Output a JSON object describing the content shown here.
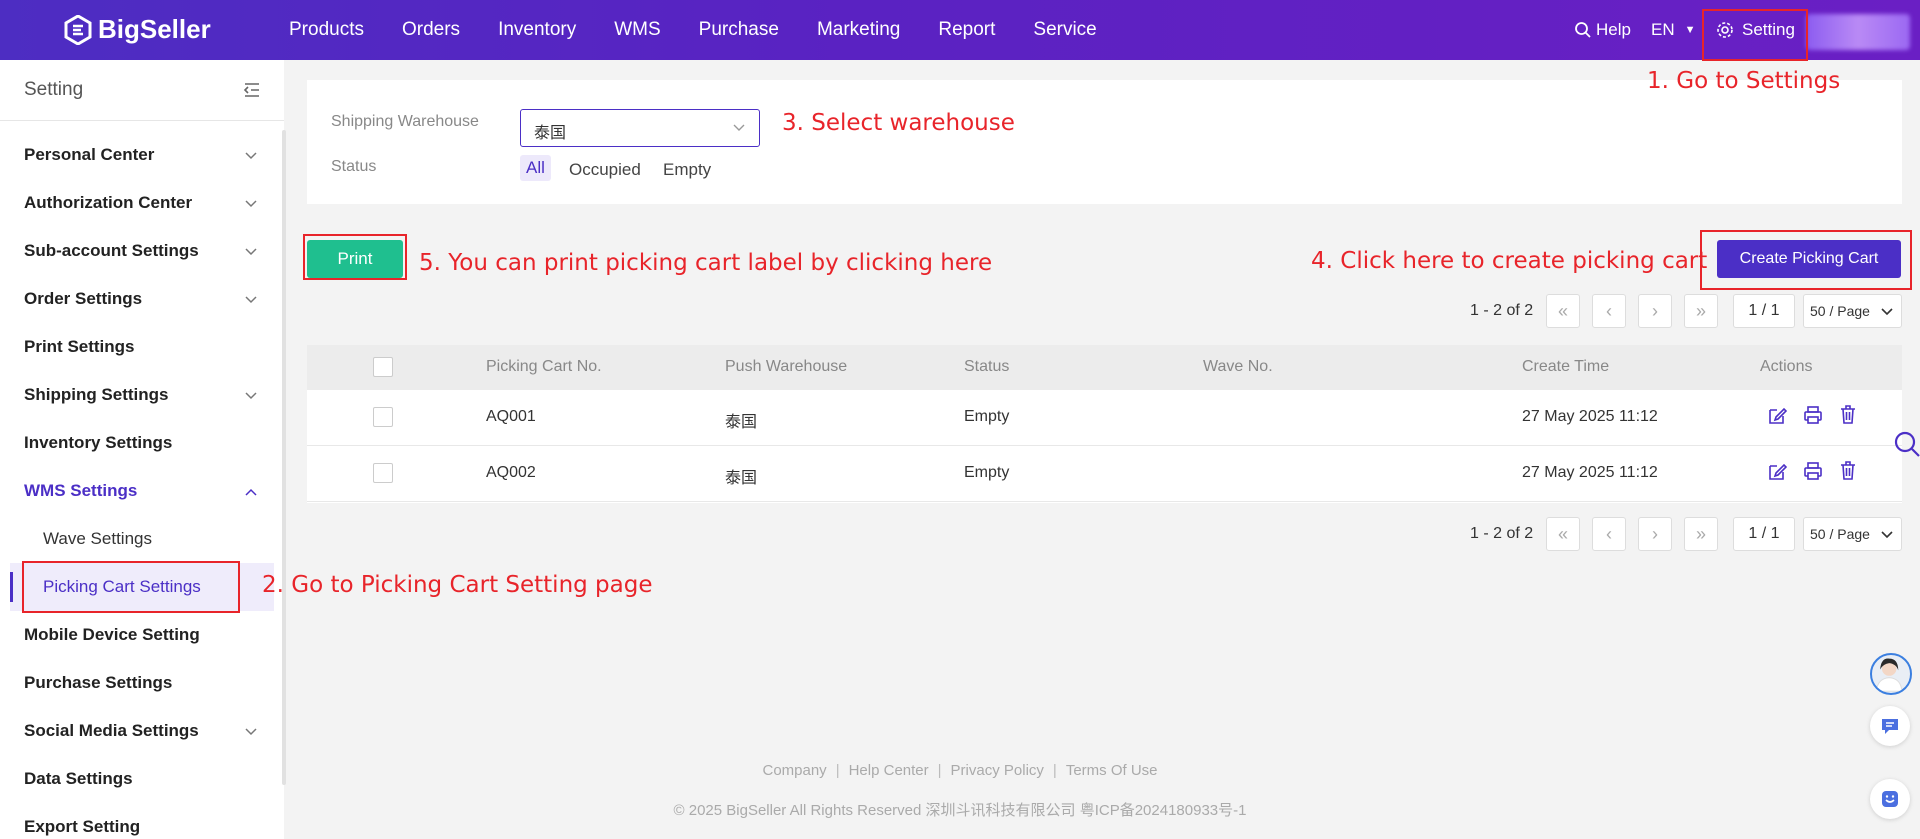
{
  "brand": {
    "name": "BigSeller"
  },
  "nav": {
    "items": [
      "Products",
      "Orders",
      "Inventory",
      "WMS",
      "Purchase",
      "Marketing",
      "Report",
      "Service"
    ]
  },
  "topright": {
    "help": "Help",
    "lang": "EN",
    "setting": "Setting"
  },
  "annotations": {
    "a1": "1. Go to Settings",
    "a2": "2. Go to Picking Cart Setting page",
    "a3": "3. Select warehouse",
    "a4": "4. Click here to create picking cart",
    "a5": "5. You can print picking cart label by clicking here"
  },
  "sidebar": {
    "title": "Setting",
    "items": [
      {
        "label": "Personal Center"
      },
      {
        "label": "Authorization Center"
      },
      {
        "label": "Sub-account Settings"
      },
      {
        "label": "Order Settings"
      },
      {
        "label": "Print Settings"
      },
      {
        "label": "Shipping Settings"
      },
      {
        "label": "Inventory Settings"
      },
      {
        "label": "WMS Settings"
      },
      {
        "label": "Mobile Device Setting"
      },
      {
        "label": "Purchase Settings"
      },
      {
        "label": "Social Media Settings"
      },
      {
        "label": "Data Settings"
      },
      {
        "label": "Export Setting"
      }
    ],
    "sub": [
      "Wave Settings",
      "Picking Cart Settings"
    ]
  },
  "filter": {
    "warehouse_label": "Shipping Warehouse",
    "warehouse_value": "泰国",
    "status_label": "Status",
    "status_options": [
      "All",
      "Occupied",
      "Empty"
    ]
  },
  "buttons": {
    "print": "Print",
    "create": "Create Picking Cart"
  },
  "pager": {
    "total": "1 - 2 of 2",
    "page": "1 / 1",
    "size": "50 / Page"
  },
  "table": {
    "headers": [
      "Picking Cart No.",
      "Push Warehouse",
      "Status",
      "Wave No.",
      "Create Time",
      "Actions"
    ],
    "rows": [
      {
        "no": "AQ001",
        "warehouse": "泰国",
        "status": "Empty",
        "wave": "",
        "time": "27 May 2025 11:12"
      },
      {
        "no": "AQ002",
        "warehouse": "泰国",
        "status": "Empty",
        "wave": "",
        "time": "27 May 2025 11:12"
      }
    ]
  },
  "footer": {
    "links": [
      "Company",
      "Help Center",
      "Privacy Policy",
      "Terms Of Use"
    ],
    "copyright": "© 2025 BigSeller All Rights Reserved   深圳斗讯科技有限公司   粤ICP备2024180933号-1"
  },
  "colors": {
    "brand": "#4b2fc6",
    "print": "#1fbf8f",
    "annotation": "#e8242a"
  }
}
